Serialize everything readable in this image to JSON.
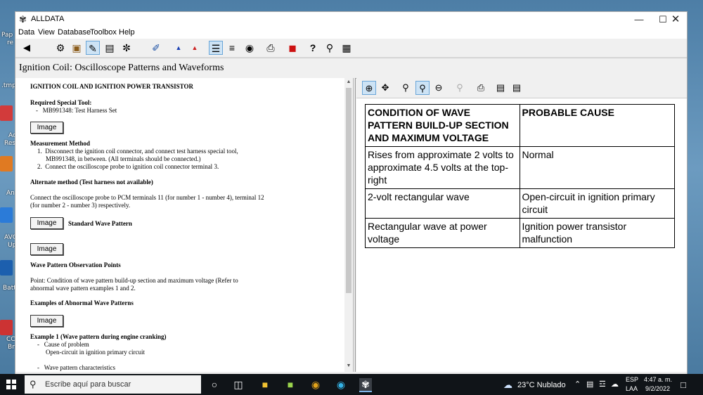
{
  "window": {
    "title": "ALLDATA"
  },
  "menu": [
    "Data",
    "View",
    "Database",
    "Toolbox",
    "Help"
  ],
  "document": {
    "title": "Ignition Coil:  Oscilloscope Patterns and Waveforms"
  },
  "desktop": {
    "labels": [
      "Pap",
      "re",
      ".tmp",
      "Ac",
      "Res",
      "An",
      "AVG",
      "Up",
      "Batt",
      "CC",
      "Br"
    ]
  },
  "left": {
    "heading": "IGNITION COIL AND IGNITION POWER TRANSISTOR",
    "required_tool_label": "Required Special Tool:",
    "required_tool_item": "MB991348: Test Harness Set",
    "image_button": "Image",
    "measurement_method": "Measurement Method",
    "steps": [
      "Disconnect the ignition coil connector, and connect test harness special tool,",
      "MB991348, in between. (All terminals should be connected.)",
      "Connect the oscilloscope probe to ignition coil connector terminal 3."
    ],
    "alt_method": "Alternate method (Test harness not available)",
    "alt_text_1": "Connect the oscilloscope probe to PCM terminals 11 (for number 1 - number 4), terminal 12",
    "alt_text_2": "(for number 2 - number 3) respectively.",
    "standard_wave": "Standard Wave Pattern",
    "observation_points": "Wave Pattern Observation Points",
    "point_text_1": "Point: Condition of wave pattern build-up section and maximum voltage (Refer to",
    "point_text_2": "abnormal wave pattern examples 1 and 2.",
    "examples_heading": "Examples of Abnormal Wave Patterns",
    "example1": "Example 1 (Wave pattern during engine cranking)",
    "cause_of_problem": "Cause of problem",
    "cause_value": "Open-circuit in ignition primary circuit",
    "wave_characteristics": "Wave pattern characteristics"
  },
  "table": {
    "header": [
      "CONDITION OF WAVE PATTERN BUILD-UP SECTION AND MAXIMUM VOLTAGE",
      "PROBABLE CAUSE"
    ],
    "rows": [
      [
        "Rises from approximate 2 volts to approximate 4.5 volts at the top-right",
        "Normal"
      ],
      [
        "2-volt rectangular wave",
        "Open-circuit in ignition primary circuit"
      ],
      [
        "Rectangular wave at power voltage",
        "Ignition power transistor malfunction"
      ]
    ]
  },
  "taskbar": {
    "search_placeholder": "Escribe aquí para buscar",
    "weather": "23°C  Nublado",
    "lang_1": "ESP",
    "lang_2": "LAA",
    "time": "4:47 a. m.",
    "date": "9/2/2022"
  },
  "colors": {
    "accent": "#0078d7",
    "selected_tool": "#cde3f5",
    "taskbar": "#101418"
  }
}
